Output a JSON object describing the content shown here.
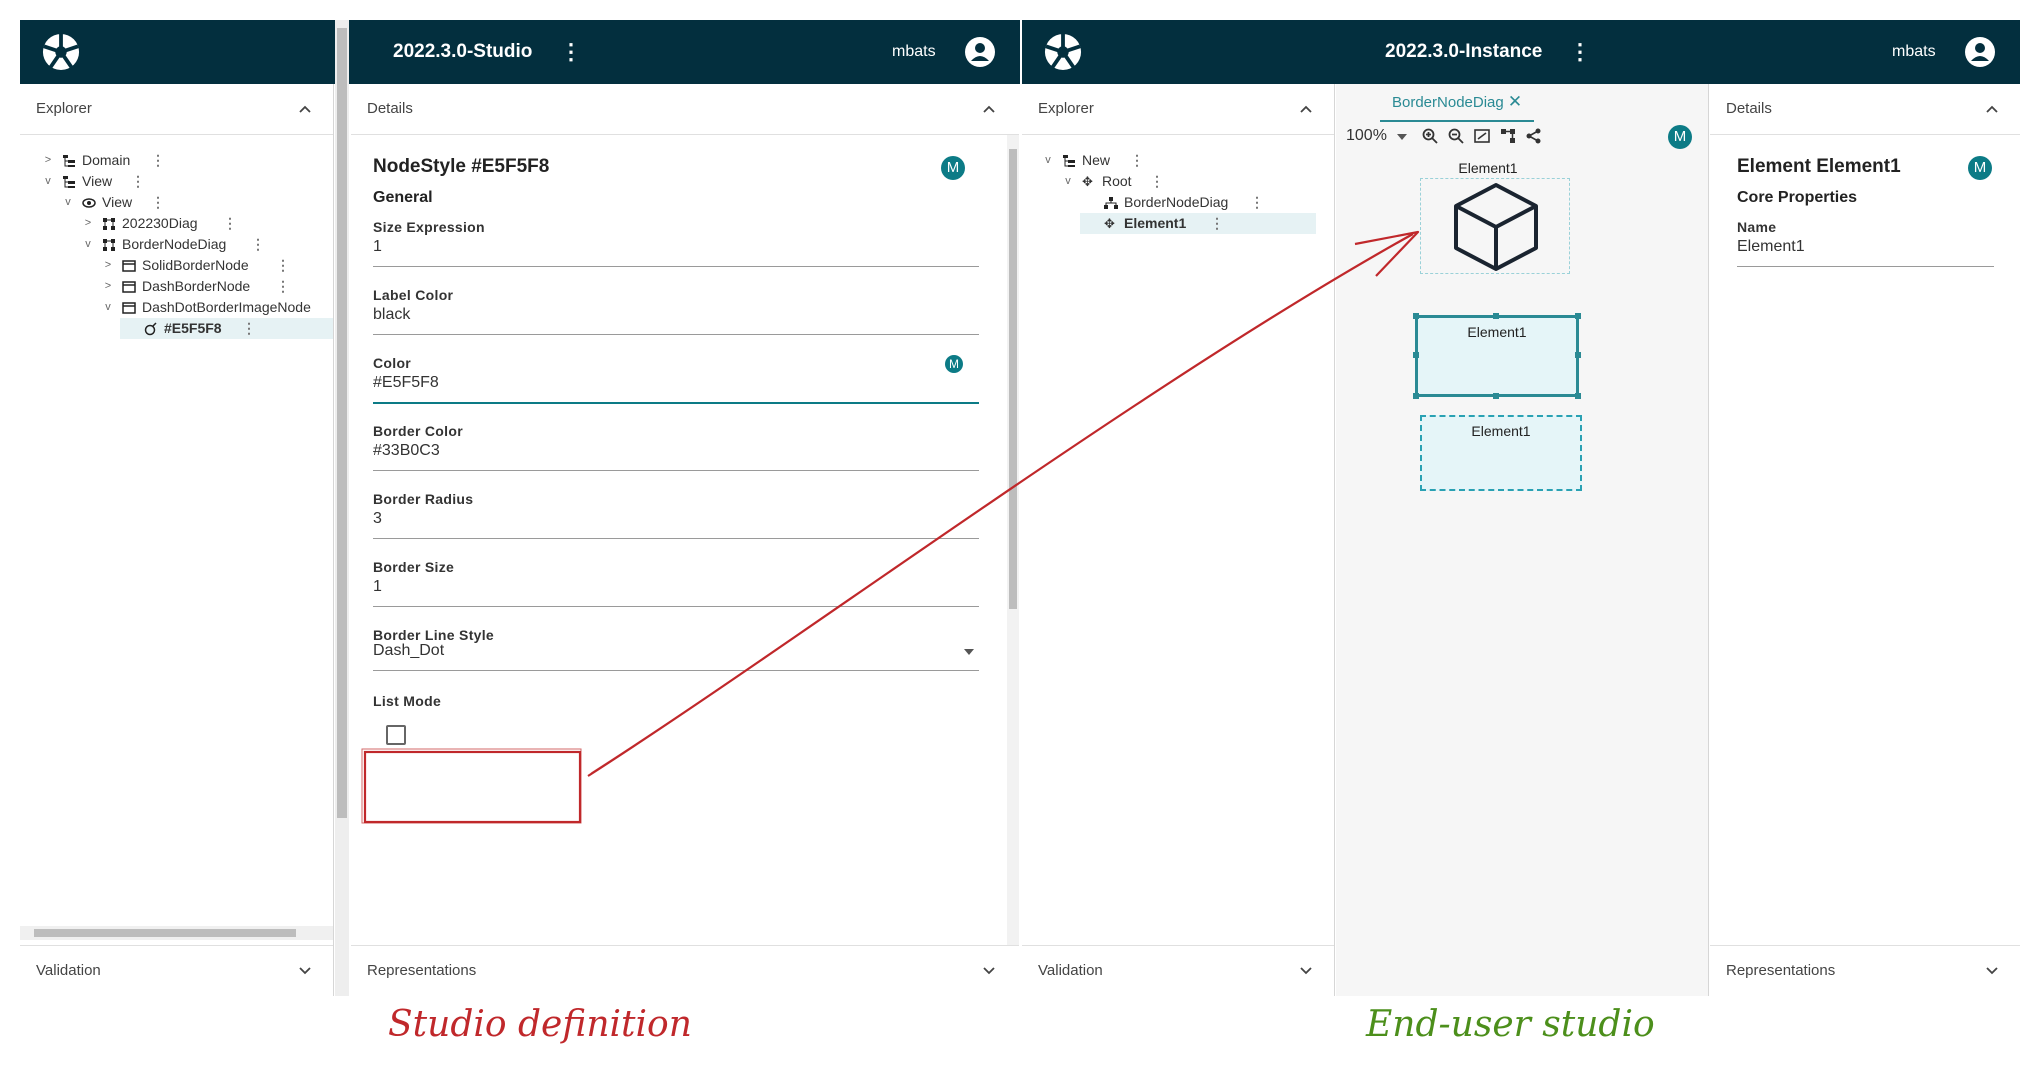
{
  "studio": {
    "title": "2022.3.0-Studio",
    "user": "mbats",
    "explorer": {
      "title": "Explorer",
      "tree": [
        {
          "label": "Domain",
          "twisty": ">"
        },
        {
          "label": "View",
          "twisty": "v"
        },
        {
          "label": "View",
          "twisty": "v"
        },
        {
          "label": "202230Diag",
          "twisty": ">"
        },
        {
          "label": "BorderNodeDiag",
          "twisty": "v"
        },
        {
          "label": "SolidBorderNode",
          "twisty": ">"
        },
        {
          "label": "DashBorderNode",
          "twisty": ">"
        },
        {
          "label": "DashDotBorderImageNode",
          "twisty": "v"
        },
        {
          "label": "#E5F5F8",
          "twisty": ""
        }
      ]
    },
    "validation": "Validation",
    "details": {
      "title": "Details",
      "object_title": "NodeStyle #E5F5F8",
      "badge": "M",
      "section": "General",
      "fields": [
        {
          "label": "Size Expression",
          "value": "1"
        },
        {
          "label": "Label Color",
          "value": "black"
        },
        {
          "label": "Color",
          "value": "#E5F5F8"
        },
        {
          "label": "Border Color",
          "value": "#33B0C3"
        },
        {
          "label": "Border Radius",
          "value": "3"
        },
        {
          "label": "Border Size",
          "value": "1"
        },
        {
          "label": "Border Line Style",
          "value": "Dash_Dot"
        },
        {
          "label": "List Mode",
          "value": ""
        }
      ]
    },
    "representations": "Representations"
  },
  "instance": {
    "title": "2022.3.0-Instance",
    "user": "mbats",
    "explorer": {
      "title": "Explorer",
      "tree": [
        {
          "label": "New",
          "twisty": "v"
        },
        {
          "label": "Root",
          "twisty": "v"
        },
        {
          "label": "BorderNodeDiag",
          "twisty": ""
        },
        {
          "label": "Element1",
          "twisty": ""
        }
      ]
    },
    "validation": "Validation",
    "canvas": {
      "tab": "BorderNodeDiag",
      "zoom": "100%",
      "badge": "M",
      "nodes": [
        "Element1",
        "Element1",
        "Element1"
      ]
    },
    "details": {
      "title": "Details",
      "object_title": "Element Element1",
      "badge": "M",
      "section": "Core Properties",
      "field_label": "Name",
      "field_value": "Element1"
    },
    "representations": "Representations"
  },
  "annotations": {
    "left": "Studio definition",
    "right": "End-user studio",
    "left_color": "#c0282b",
    "right_color": "#4c8f1b"
  },
  "colors": {
    "topbar": "#032f3e",
    "accent": "#0c7b86"
  }
}
